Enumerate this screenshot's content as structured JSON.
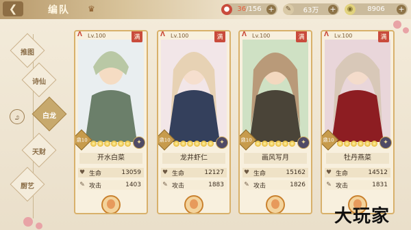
{
  "header": {
    "back_icon": "back-arrow-icon",
    "title": "编队",
    "crown_icon": "crown-icon"
  },
  "resources": [
    {
      "icon": "stamina-icon",
      "current": "36",
      "separator": "/156"
    },
    {
      "icon": "silver-icon",
      "value": "63万"
    },
    {
      "icon": "jade-icon",
      "value": "8906"
    }
  ],
  "sidebar": {
    "emblem_icon": "swirl-emblem-icon",
    "items": [
      {
        "label": "推图",
        "active": false
      },
      {
        "label": "诗仙",
        "active": false
      },
      {
        "label": "白龙",
        "active": true
      },
      {
        "label": "天财",
        "active": false
      },
      {
        "label": "厨艺",
        "active": false
      }
    ]
  },
  "cards": [
    {
      "level": "Lv.100",
      "seal": "满",
      "tier": "鼎10",
      "stars": 6,
      "badge_icon": "skill-badge-icon",
      "name": "开水白菜",
      "hp_label": "生命",
      "hp": "13059",
      "atk_label": "攻击",
      "atk": "1403",
      "palette": [
        "#e9eef0",
        "#6b7f6a",
        "#b9c8a5"
      ]
    },
    {
      "level": "Lv.100",
      "seal": "满",
      "tier": "鼎10",
      "stars": 6,
      "badge_icon": "skill-badge-icon",
      "name": "龙井虾仁",
      "hp_label": "生命",
      "hp": "12127",
      "atk_label": "攻击",
      "atk": "1883",
      "palette": [
        "#f2e6e8",
        "#34405c",
        "#e7d2b4"
      ]
    },
    {
      "level": "Lv.100",
      "seal": "满",
      "tier": "鼎10",
      "stars": 6,
      "badge_icon": "skill-badge-icon",
      "name": "画风写月",
      "hp_label": "生命",
      "hp": "15162",
      "atk_label": "攻击",
      "atk": "1826",
      "palette": [
        "#cfe1c4",
        "#4a4438",
        "#b99a79"
      ]
    },
    {
      "level": "Lv.100",
      "seal": "满",
      "tier": "鼎10",
      "stars": 6,
      "badge_icon": "skill-badge-icon",
      "name": "牡丹燕菜",
      "hp_label": "生命",
      "hp": "14512",
      "atk_label": "攻击",
      "atk": "1831",
      "palette": [
        "#e9d6da",
        "#8d1d22",
        "#d8c8b8"
      ]
    }
  ],
  "watermark": "大玩家"
}
